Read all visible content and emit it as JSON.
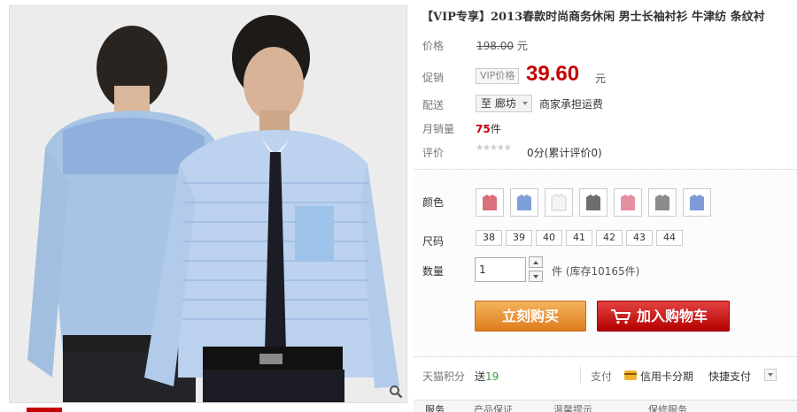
{
  "product": {
    "title": "【VIP专享】2013春款时尚商务休闲 男士长袖衬衫 牛津纺 条纹衬",
    "original_price": "198.00",
    "currency_unit": "元",
    "vip_tag": "VIP价格",
    "promo_price": "39.60",
    "monthly_sales": "75",
    "sales_unit": "件",
    "rating_stars": "★★★★★",
    "review_summary": "0分(累计评价0)"
  },
  "labels": {
    "price": "价格",
    "promo": "促销",
    "shipping": "配送",
    "monthly_sales": "月销量",
    "rating": "评价",
    "color": "颜色",
    "size": "尺码",
    "quantity": "数量",
    "points": "天猫积分",
    "payment": "支付"
  },
  "shipping": {
    "destination": "至 廊坊",
    "note": "商家承担运费"
  },
  "colors": {
    "swatches": [
      "#d9707a",
      "#7f9fd8",
      "#f4f4f4",
      "#6e6e6e",
      "#e58fa2",
      "#8c8c8c",
      "#7d9bd6"
    ]
  },
  "sizes": [
    "38",
    "39",
    "40",
    "41",
    "42",
    "43",
    "44"
  ],
  "quantity": {
    "value": "1",
    "stock_text": "件 (库存10165件)"
  },
  "buttons": {
    "buy_now": "立刻购买",
    "add_to_cart": "加入购物车"
  },
  "points": {
    "prefix": "送",
    "amount": "19"
  },
  "payment": {
    "installment": "信用卡分期",
    "quick": "快捷支付"
  },
  "tabs": [
    "服务",
    "产品保证",
    "温馨提示",
    "保修服务"
  ]
}
